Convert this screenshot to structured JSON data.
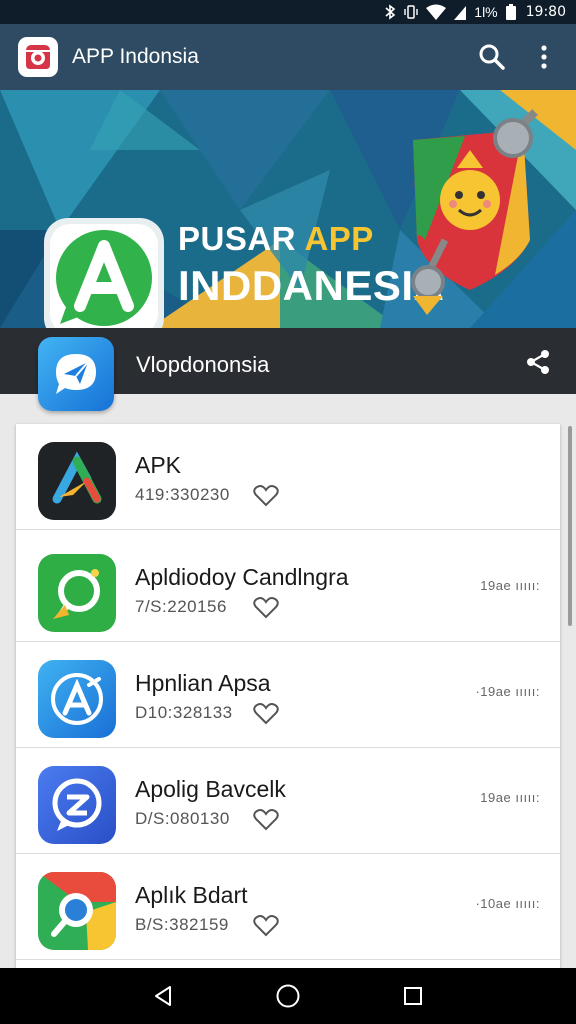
{
  "status_bar": {
    "battery": "1l%",
    "time": "19:80"
  },
  "app_bar": {
    "title": "APP Indonsia"
  },
  "banner": {
    "title_line1_part1": "PUSAR ",
    "title_line1_part2": "APP",
    "title_line2": "INDDANESIA",
    "dots": [
      "#e74c3c",
      "#ffffff",
      "#f1c40f",
      "#2c3e50"
    ]
  },
  "section": {
    "title": "Vlopdononsia"
  },
  "apps": [
    {
      "name": "APK",
      "meta": "419:330230",
      "size": "",
      "icon": "apk-icon"
    },
    {
      "name": "Apldiodoy Candlngra",
      "meta": "7/S:220156",
      "size": "19ae ııııı:",
      "icon": "whatsapp-icon"
    },
    {
      "name": "Hpnlian Apsa",
      "meta": "D10:328133",
      "size": "·19ae ııııı:",
      "icon": "appstore-icon"
    },
    {
      "name": "Apolig Bavcelk",
      "meta": "D/S:080130",
      "size": "19ae ııııı:",
      "icon": "messenger-icon"
    },
    {
      "name": "Aplık Bdart",
      "meta": "B/S:382159",
      "size": "·10ae ııııı:",
      "icon": "chrome-icon"
    }
  ],
  "colors": {
    "app_bar": "#2f4b63",
    "status_bar": "#0f1d2b",
    "section_header": "#2a2d31"
  }
}
